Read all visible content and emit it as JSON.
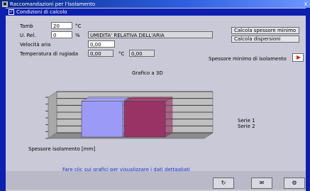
{
  "window": {
    "title": "Raccomandazioni per l'isolamento",
    "close": "X"
  },
  "header": {
    "label": "Condizioni di calcolo"
  },
  "form": {
    "row1": {
      "label": "Tamb",
      "value": "20",
      "unit": "°C"
    },
    "row2": {
      "label": "U. Rel.",
      "value": "0",
      "unit": "%",
      "info": "UMIDITA' RELATIVA DELL'ARIA"
    },
    "row3": {
      "label": "Velocità aria",
      "value": "0,00"
    },
    "row4": {
      "label": "Temperatura di rugiada",
      "value1": "0,00",
      "unit": "°C",
      "value2": "0,00"
    }
  },
  "buttons": {
    "calc1": "Calcola spessore minimo",
    "calc2": "Calcola dispersioni",
    "next_label": "Spessore minimo di isolamento"
  },
  "chart_data": {
    "type": "bar",
    "title": "Grafico a 3D",
    "categories": [
      "Serie 1",
      "Serie 2"
    ],
    "values": [
      5,
      5
    ],
    "ylim": [
      0,
      6
    ],
    "colors": [
      "#9b9bf7",
      "#993366"
    ],
    "xlabel": "Spessore isolamento [mm]"
  },
  "legend": {
    "items": [
      "Serie 1",
      "Serie 2"
    ]
  },
  "footer": {
    "text": "Fare clic sui grafici per visualizzare i dati dettagliati"
  },
  "toolbar": {
    "btn1": "↻",
    "btn2": "✉",
    "btn3": "⚙"
  }
}
